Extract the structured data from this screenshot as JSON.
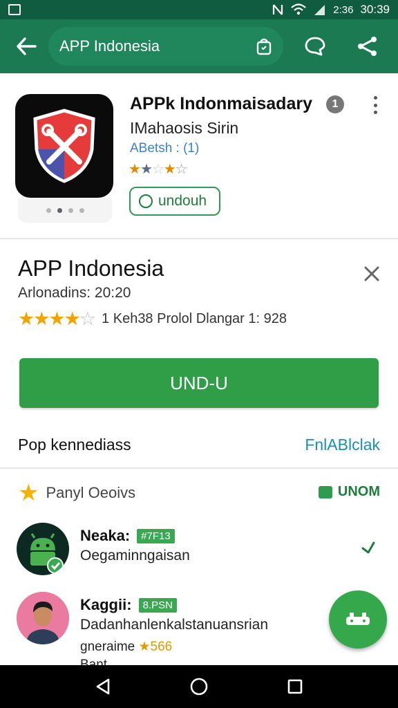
{
  "status_bar": {
    "icons": [
      "image-icon",
      "nfc-icon",
      "wifi-icon",
      "signal-icon"
    ],
    "extra": "2:36",
    "time": "30:39"
  },
  "app_bar": {
    "search_text": "APP Indonesia",
    "icons": [
      "back-icon",
      "bag-icon",
      "chat-icon",
      "share-icon"
    ]
  },
  "top_card": {
    "title": "APPk Indonmaisadary",
    "subtitle": "IMahaosis Sirin",
    "rating_text": "ABetsh : (1)",
    "stars": "★★☆★☆",
    "badge": "1",
    "unduh_label": "undouh",
    "logo_icon": "shield-tools-icon"
  },
  "main": {
    "title": "APP Indonesia",
    "meta": "Arlonadins: 20:20",
    "stars_filled": "★★★★",
    "stars_half": "☆",
    "rating_value": 4.5,
    "rating_text": "1 Keh38 Prolol Dlangar 1: 928",
    "install_label": "UND-U",
    "pop_label": "Pop kennediass",
    "pop_link": "FnlABlclak"
  },
  "reviews": {
    "header_label": "Panyl Oeoivs",
    "header_action": "UNOM",
    "items": [
      {
        "name": "Neaka:",
        "chip": "#7F13",
        "text": "Oegaminngaisan",
        "avatar": "android-icon"
      },
      {
        "name": "Kaggii:",
        "chip": "8.PSN",
        "text": "Dadanhanlenkalstanuansrian",
        "text2": "gneraime",
        "score": "★566",
        "avatar": "person-avatar"
      }
    ],
    "partial_text": "Bant"
  },
  "fab_icon": "gamepad-icon",
  "nav_bar": {
    "icons": [
      "back-triangle-icon",
      "home-circle-icon",
      "recents-square-icon"
    ]
  },
  "colors": {
    "app_bar": "#1b7a52",
    "status_bar": "#0f5c40",
    "install": "#2f9e47",
    "link": "#1a8fb1",
    "star": "#f2a300"
  }
}
